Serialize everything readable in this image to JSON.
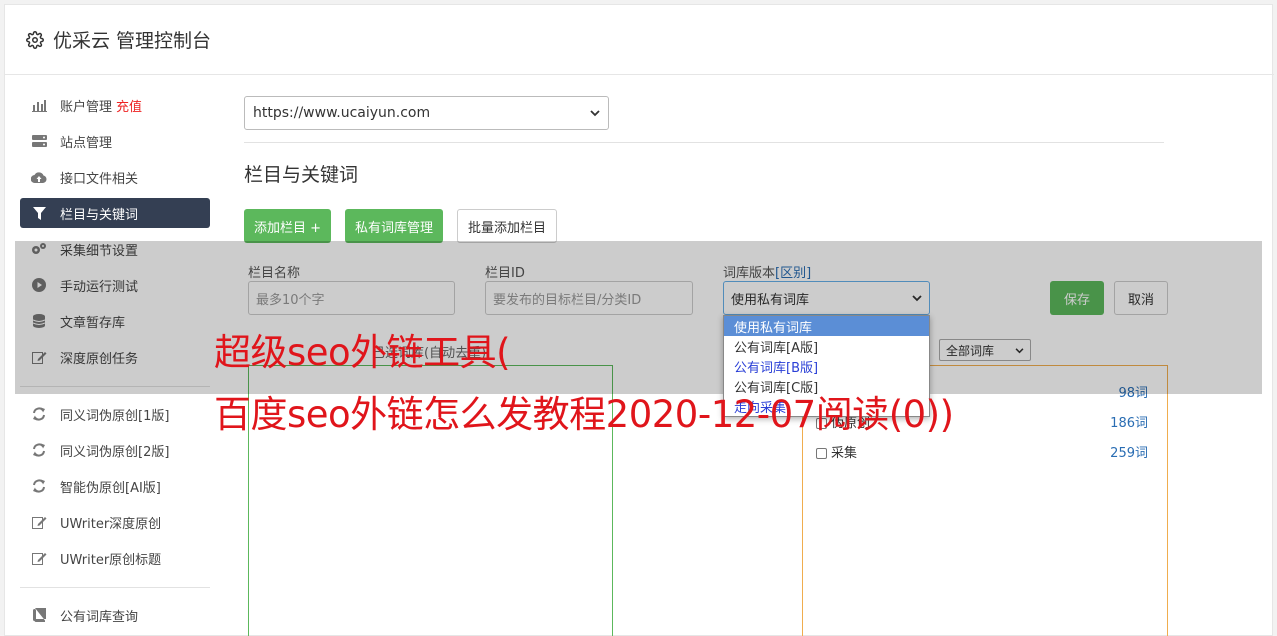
{
  "app": {
    "title": "优采云 管理控制台"
  },
  "sidebar": {
    "group1": [
      {
        "label": "账户管理",
        "extra": "充值",
        "icon": "bar-chart-icon"
      },
      {
        "label": "站点管理",
        "icon": "server-icon"
      },
      {
        "label": "接口文件相关",
        "icon": "cloud-upload-icon"
      },
      {
        "label": "栏目与关键词",
        "icon": "filter-icon",
        "active": true
      },
      {
        "label": "采集细节设置",
        "icon": "cogs-icon"
      },
      {
        "label": "手动运行测试",
        "icon": "play-circle-icon"
      },
      {
        "label": "文章暂存库",
        "icon": "database-icon"
      },
      {
        "label": "深度原创任务",
        "icon": "edit-icon"
      }
    ],
    "group2": [
      {
        "label": "同义词伪原创[1版]",
        "icon": "refresh-icon"
      },
      {
        "label": "同义词伪原创[2版]",
        "icon": "refresh-icon"
      },
      {
        "label": "智能伪原创[AI版]",
        "icon": "refresh-icon"
      },
      {
        "label": "UWriter深度原创",
        "icon": "edit-icon"
      },
      {
        "label": "UWriter原创标题",
        "icon": "edit-icon"
      }
    ],
    "group3": [
      {
        "label": "公有词库查询",
        "icon": "book-icon"
      }
    ]
  },
  "main": {
    "site_select": "https://www.ucaiyun.com",
    "section_title": "栏目与关键词",
    "buttons": {
      "add_column": "添加栏目 +",
      "private_lib": "私有词库管理",
      "batch_add": "批量添加栏目"
    },
    "form": {
      "name_label": "栏目名称",
      "name_placeholder": "最多10个字",
      "id_label": "栏目ID",
      "id_placeholder": "要发布的目标栏目/分类ID",
      "lib_label": "词库版本",
      "lib_label_link": "[区别]",
      "lib_value": "使用私有词库",
      "save": "保存",
      "cancel": "取消"
    },
    "left_box_hint": "已选词库(自动去重)",
    "lib_filter": "全部词库",
    "lib_rows": [
      {
        "name": "",
        "count": "98词"
      },
      {
        "name": "伪原创",
        "count": "186词"
      },
      {
        "name": "采集",
        "count": "259词"
      }
    ],
    "dropdown_options": [
      "使用私有词库",
      "公有词库[A版]",
      "公有词库[B版]",
      "公有词库[C版]",
      "走向采集"
    ]
  },
  "watermark": {
    "line1": "超级seo外链工具(",
    "line2": "百度seo外链怎么发教程2020-12-07阅读(0))"
  },
  "colors": {
    "accent_green": "#5cb85c",
    "active_nav": "#343f53",
    "watermark_red": "#e0151b",
    "link_blue": "#2a6db3"
  }
}
